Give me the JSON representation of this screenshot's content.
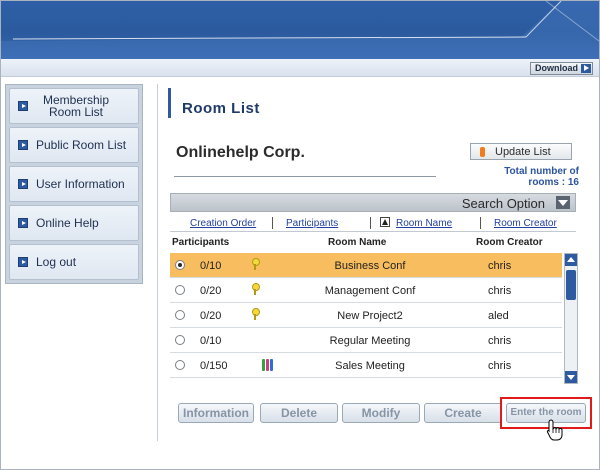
{
  "header": {
    "download_label": "Download"
  },
  "sidebar": {
    "items": [
      {
        "label": "Membership Room List"
      },
      {
        "label": "Public Room List"
      },
      {
        "label": "User Information"
      },
      {
        "label": "Online Help"
      },
      {
        "label": "Log out"
      }
    ]
  },
  "main": {
    "title": "Room List",
    "company": "Onlinehelp Corp.",
    "update_label": "Update List",
    "total_label": "Total number of",
    "total_value": "rooms : 16",
    "search_option_label": "Search Option",
    "sort_links": {
      "creation_order": "Creation Order",
      "participants": "Participants",
      "room_name": "Room Name",
      "room_creator": "Room Creator"
    },
    "columns": {
      "participants": "Participants",
      "room_name": "Room Name",
      "room_creator": "Room Creator"
    },
    "rooms": [
      {
        "participants": "0/10",
        "room_name": "Business Conf",
        "creator": "chris",
        "icon": "key-icon",
        "selected": true
      },
      {
        "participants": "0/20",
        "room_name": "Management Conf",
        "creator": "chris",
        "icon": "key-icon",
        "selected": false
      },
      {
        "participants": "0/20",
        "room_name": "New Project2",
        "creator": "aled",
        "icon": "key-icon",
        "selected": false
      },
      {
        "participants": "0/10",
        "room_name": "Regular Meeting",
        "creator": "chris",
        "icon": "",
        "selected": false
      },
      {
        "participants": "0/150",
        "room_name": "Sales Meeting",
        "creator": "chris",
        "icon": "people-icon",
        "selected": false
      }
    ],
    "buttons": {
      "information": "Information",
      "delete": "Delete",
      "modify": "Modify",
      "create": "Create",
      "enter_room": "Enter the room"
    }
  },
  "colors": {
    "accent": "#2d5aa0",
    "selected_row": "#f7bd5f",
    "highlight": "#e21a1a"
  }
}
